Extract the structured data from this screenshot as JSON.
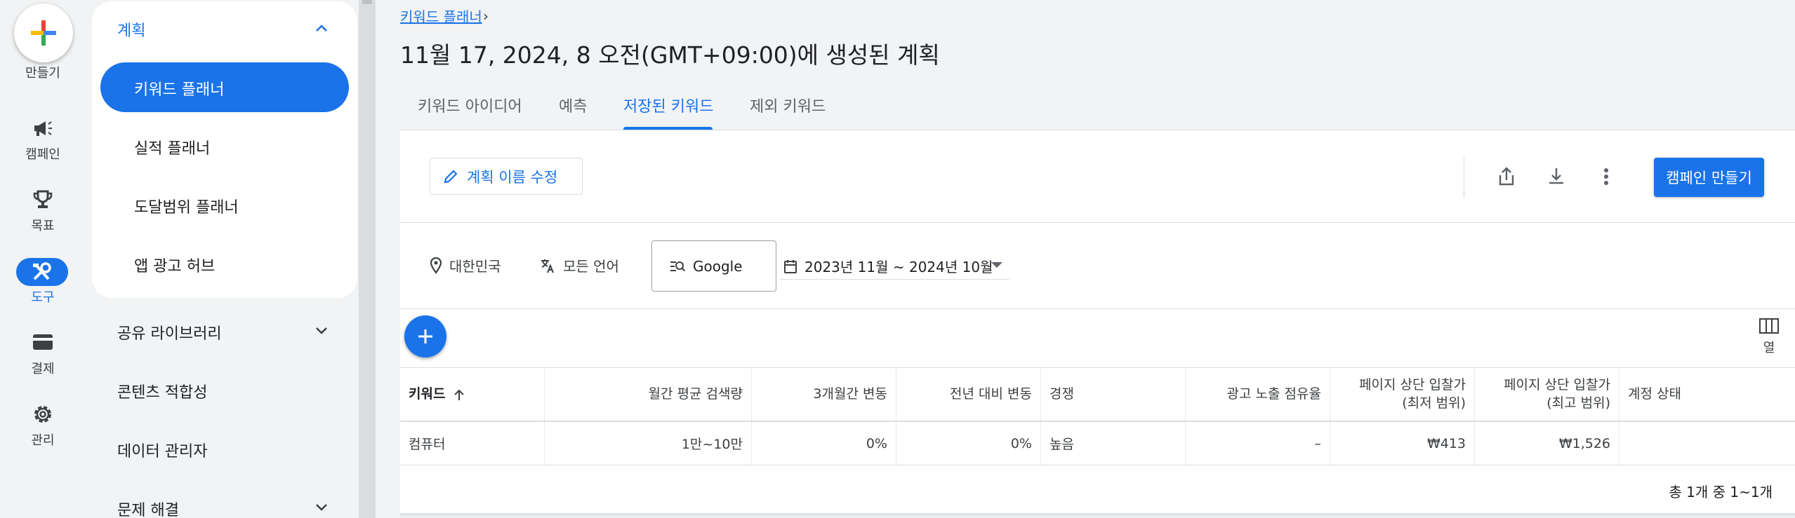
{
  "rail": {
    "create_label": "만들기",
    "items": [
      {
        "label": "캠페인",
        "icon": "megaphone-icon"
      },
      {
        "label": "목표",
        "icon": "trophy-icon"
      },
      {
        "label": "도구",
        "icon": "tools-icon",
        "active": true
      },
      {
        "label": "결제",
        "icon": "credit-card-icon"
      },
      {
        "label": "관리",
        "icon": "gear-icon"
      }
    ]
  },
  "subnav": {
    "section_title": "계획",
    "items": [
      {
        "label": "키워드 플래너",
        "active": true
      },
      {
        "label": "실적 플래너"
      },
      {
        "label": "도달범위 플래너"
      },
      {
        "label": "앱 광고 허브"
      }
    ],
    "groups": [
      {
        "label": "공유 라이브러리",
        "expandable": true
      },
      {
        "label": "콘텐츠 적합성"
      },
      {
        "label": "데이터 관리자"
      },
      {
        "label": "문제 해결",
        "expandable": true
      }
    ]
  },
  "breadcrumb": "키워드 플래너",
  "page_title": "11월 17, 2024, 8 오전(GMT+09:00)에 생성된 계획",
  "tabs": [
    {
      "label": "키워드 아이디어"
    },
    {
      "label": "예측"
    },
    {
      "label": "저장된 키워드",
      "active": true
    },
    {
      "label": "제외 키워드"
    }
  ],
  "toolbar": {
    "edit_label": "계획 이름 수정",
    "create_campaign_label": "캠페인 만들기"
  },
  "filters": {
    "location": "대한민국",
    "language": "모든 언어",
    "network": "Google",
    "date_range": "2023년 11월 ~ 2024년 10월"
  },
  "columns_label": "열",
  "table": {
    "headers": [
      "키워드",
      "월간 평균 검색량",
      "3개월간 변동",
      "전년 대비 변동",
      "경쟁",
      "광고 노출 점유율",
      "페이지 상단 입찰가\n(최저 범위)",
      "페이지 상단 입찰가\n(최고 범위)",
      "계정 상태"
    ],
    "rows": [
      [
        "컴퓨터",
        "1만~10만",
        "0%",
        "0%",
        "높음",
        "–",
        "₩413",
        "₩1,526",
        ""
      ]
    ]
  },
  "pagination": "총 1개 중 1~1개",
  "colors": {
    "accent": "#1a73e8",
    "background": "#f1f3f4"
  }
}
